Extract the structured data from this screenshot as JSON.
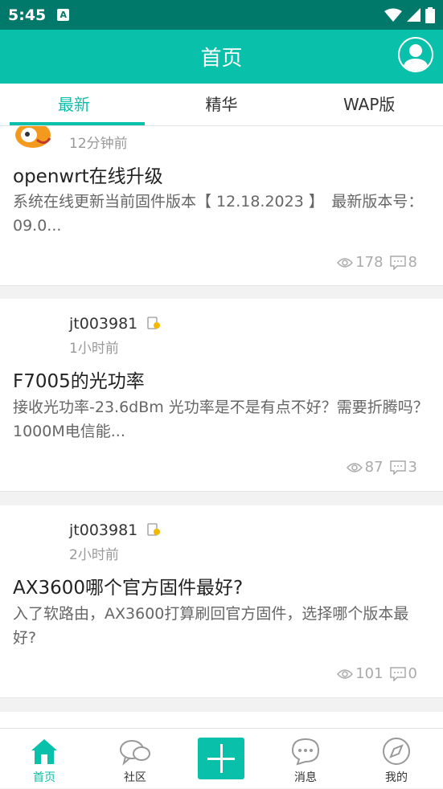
{
  "status_bar": {
    "time": "5:45",
    "app_icon": "A"
  },
  "header": {
    "title": "首页"
  },
  "tabs": [
    {
      "label": "最新"
    },
    {
      "label": "精华"
    },
    {
      "label": "WAP版"
    }
  ],
  "posts": [
    {
      "user": "",
      "time": "12分钟前",
      "title": "openwrt在线升级",
      "excerpt": "系统在线更新当前固件版本【 12.18.2023 】　最新版本号：09.0...",
      "views": "178",
      "comments": "8"
    },
    {
      "user": "jt003981",
      "time": "1小时前",
      "title": "F7005的光功率",
      "excerpt": "接收光功率-23.6dBm  光功率是不是有点不好？需要折腾吗？1000M电信能...",
      "views": "87",
      "comments": "3"
    },
    {
      "user": "jt003981",
      "time": "2小时前",
      "title": "AX3600哪个官方固件最好?",
      "excerpt": "入了软路由，AX3600打算刷回官方固件，选择哪个版本最好?",
      "views": "101",
      "comments": "0"
    }
  ],
  "bottom_nav": [
    {
      "label": "首页",
      "icon": "home-icon"
    },
    {
      "label": "社区",
      "icon": "chat-bubbles-icon"
    },
    {
      "label": "",
      "icon": "plus-icon"
    },
    {
      "label": "消息",
      "icon": "message-icon"
    },
    {
      "label": "我的",
      "icon": "compass-icon"
    }
  ],
  "colors": {
    "primary": "#09c0ab",
    "status_bar": "#00796b"
  }
}
